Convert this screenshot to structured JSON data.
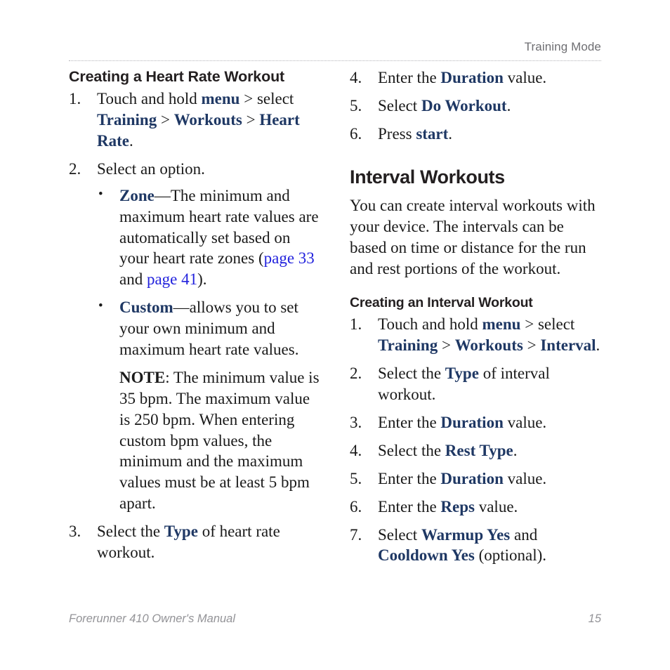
{
  "document": {
    "running_head": "Training Mode",
    "footer_left": "Forerunner 410 Owner's Manual",
    "footer_page_number": "15"
  },
  "colors": {
    "term_navy": "#1f3864",
    "link_blue": "#2222dd",
    "heading_black": "#231f20",
    "running_head_gray": "#6e6e72",
    "footer_gray": "#939397",
    "rule_gray": "#b4b4b8"
  },
  "left_column": {
    "heading": "Creating a Heart Rate Workout",
    "steps": [
      {
        "number": "1.",
        "parts": [
          {
            "type": "plain",
            "text": "Touch and hold "
          },
          {
            "type": "term",
            "text": "menu"
          },
          {
            "type": "plain",
            "text": " > select "
          },
          {
            "type": "term",
            "text": "Training"
          },
          {
            "type": "plain",
            "text": " > "
          },
          {
            "type": "term",
            "text": "Workouts"
          },
          {
            "type": "plain",
            "text": " > "
          },
          {
            "type": "term",
            "text": "Heart Rate"
          },
          {
            "type": "plain",
            "text": "."
          }
        ]
      },
      {
        "number": "2.",
        "parts": [
          {
            "type": "plain",
            "text": "Select an option."
          }
        ],
        "bullets": [
          {
            "parts": [
              {
                "type": "term",
                "text": "Zone"
              },
              {
                "type": "plain",
                "text": "—The minimum and maximum heart rate values are automatically set based on your heart rate zones ("
              },
              {
                "type": "link",
                "text": "page 33"
              },
              {
                "type": "plain",
                "text": " and "
              },
              {
                "type": "link",
                "text": "page 41"
              },
              {
                "type": "plain",
                "text": ")."
              }
            ]
          },
          {
            "parts": [
              {
                "type": "term",
                "text": "Custom"
              },
              {
                "type": "plain",
                "text": "—allows you to set your own minimum and maximum heart rate values."
              }
            ],
            "note": [
              {
                "type": "noteword",
                "text": "NOTE"
              },
              {
                "type": "plain",
                "text": ": The minimum value is 35 bpm. The maximum value is 250 bpm. When entering custom bpm values, the minimum and the maximum values must be at least 5 bpm apart."
              }
            ]
          }
        ]
      },
      {
        "number": "3.",
        "parts": [
          {
            "type": "plain",
            "text": "Select the "
          },
          {
            "type": "term",
            "text": "Type"
          },
          {
            "type": "plain",
            "text": " of heart rate workout."
          }
        ]
      }
    ]
  },
  "right_column": {
    "continued_steps": [
      {
        "number": "4.",
        "parts": [
          {
            "type": "plain",
            "text": "Enter the "
          },
          {
            "type": "term",
            "text": "Duration"
          },
          {
            "type": "plain",
            "text": " value."
          }
        ]
      },
      {
        "number": "5.",
        "parts": [
          {
            "type": "plain",
            "text": "Select "
          },
          {
            "type": "term",
            "text": "Do Workout"
          },
          {
            "type": "plain",
            "text": "."
          }
        ]
      },
      {
        "number": "6.",
        "parts": [
          {
            "type": "plain",
            "text": "Press "
          },
          {
            "type": "term",
            "text": "start"
          },
          {
            "type": "plain",
            "text": "."
          }
        ]
      }
    ],
    "section_heading": "Interval Workouts",
    "intro_paragraph": "You can create interval workouts with your device. The intervals can be based on time or distance for the run and rest portions of the workout.",
    "sub_heading": "Creating an Interval Workout",
    "steps": [
      {
        "number": "1.",
        "parts": [
          {
            "type": "plain",
            "text": "Touch and hold "
          },
          {
            "type": "term",
            "text": "menu"
          },
          {
            "type": "plain",
            "text": " > select "
          },
          {
            "type": "term",
            "text": "Training"
          },
          {
            "type": "plain",
            "text": " > "
          },
          {
            "type": "term",
            "text": "Workouts"
          },
          {
            "type": "plain",
            "text": " > "
          },
          {
            "type": "term",
            "text": "Interval"
          },
          {
            "type": "plain",
            "text": "."
          }
        ]
      },
      {
        "number": "2.",
        "parts": [
          {
            "type": "plain",
            "text": "Select the "
          },
          {
            "type": "term",
            "text": "Type"
          },
          {
            "type": "plain",
            "text": " of interval workout."
          }
        ]
      },
      {
        "number": "3.",
        "parts": [
          {
            "type": "plain",
            "text": "Enter the "
          },
          {
            "type": "term",
            "text": "Duration"
          },
          {
            "type": "plain",
            "text": " value."
          }
        ]
      },
      {
        "number": "4.",
        "parts": [
          {
            "type": "plain",
            "text": "Select the "
          },
          {
            "type": "term",
            "text": "Rest Type"
          },
          {
            "type": "plain",
            "text": "."
          }
        ]
      },
      {
        "number": "5.",
        "parts": [
          {
            "type": "plain",
            "text": "Enter the "
          },
          {
            "type": "term",
            "text": "Duration"
          },
          {
            "type": "plain",
            "text": " value."
          }
        ]
      },
      {
        "number": "6.",
        "parts": [
          {
            "type": "plain",
            "text": "Enter the "
          },
          {
            "type": "term",
            "text": "Reps"
          },
          {
            "type": "plain",
            "text": " value."
          }
        ]
      },
      {
        "number": "7.",
        "parts": [
          {
            "type": "plain",
            "text": "Select "
          },
          {
            "type": "term",
            "text": "Warmup Yes"
          },
          {
            "type": "plain",
            "text": " and "
          },
          {
            "type": "term",
            "text": "Cooldown Yes"
          },
          {
            "type": "plain",
            "text": " (optional)."
          }
        ]
      }
    ]
  }
}
